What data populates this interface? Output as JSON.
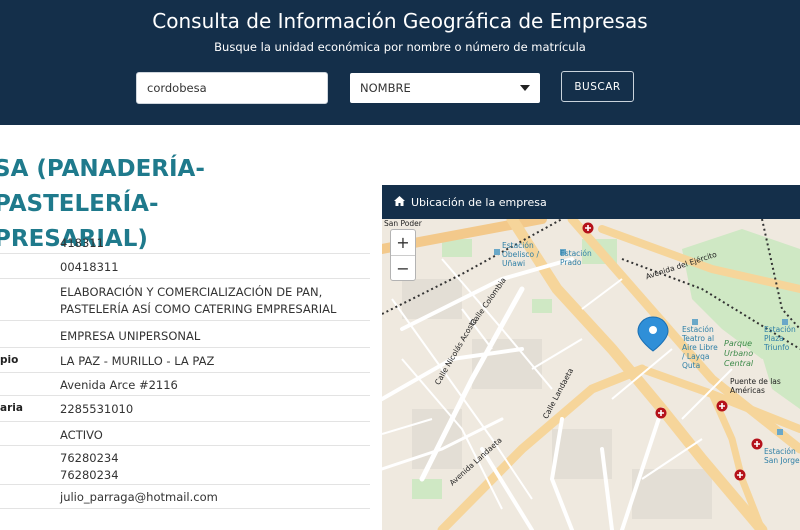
{
  "header": {
    "title": "Consulta de Información Geográfica de Empresas",
    "subtitle": "Busque la unidad económica por nombre o número de matrícula"
  },
  "search": {
    "value": "cordobesa",
    "type_selected": "NOMBRE",
    "button_label": "BUSCAR"
  },
  "company": {
    "name_line1": "SA (PANADERÍA-PASTELERÍA-",
    "name_line2": "PRESARIAL)"
  },
  "details": [
    {
      "label": "",
      "value": "418311"
    },
    {
      "label": "",
      "value": "00418311"
    },
    {
      "label": "",
      "value": "ELABORACIÓN Y COMERCIALIZACIÓN DE PAN, PASTELERÍA ASÍ COMO CATERING EMPRESARIAL"
    },
    {
      "label": "",
      "value": "EMPRESA UNIPERSONAL"
    },
    {
      "label": "pio",
      "value": "LA PAZ - MURILLO - LA PAZ"
    },
    {
      "label": "",
      "value": "Avenida Arce #2116"
    },
    {
      "label": "aria",
      "value": "2285531010"
    },
    {
      "label": "",
      "value": "ACTIVO"
    },
    {
      "label": "",
      "value": "76280234\n76280234"
    },
    {
      "label": "",
      "value": "julio_parraga@hotmail.com"
    }
  ],
  "map": {
    "panel_title": "Ubicación de la empresa",
    "zoom_in": "+",
    "zoom_out": "−",
    "labels": {
      "san_poder": "San Poder",
      "estacion_obelisco": "Estación Obelisco / Uñawi",
      "estacion_prado": "Estación Prado",
      "avenida_ejercito": "Avenida del Ejército",
      "calle_colombia": "Calle Colombia",
      "estacion_teatro": "Estación Teatro al Aire Libre / Layqa Quta",
      "parque_urbano": "Parque Urbano Central",
      "estacion_plaza": "Estación Plaza Triunfo Kimsa...",
      "puente": "Puente de las Américas",
      "calle_landaeta": "Calle Landaeta",
      "avenida_landaeta": "Avenida Landaeta",
      "calle_nicolas_acosta": "Calle Nicolás Acosta",
      "estacion_san_jorge": "Estación San Jorge"
    }
  },
  "colors": {
    "header_bg": "#142f4a",
    "accent": "#1f7a8c",
    "marker": "#2f8fd8"
  }
}
